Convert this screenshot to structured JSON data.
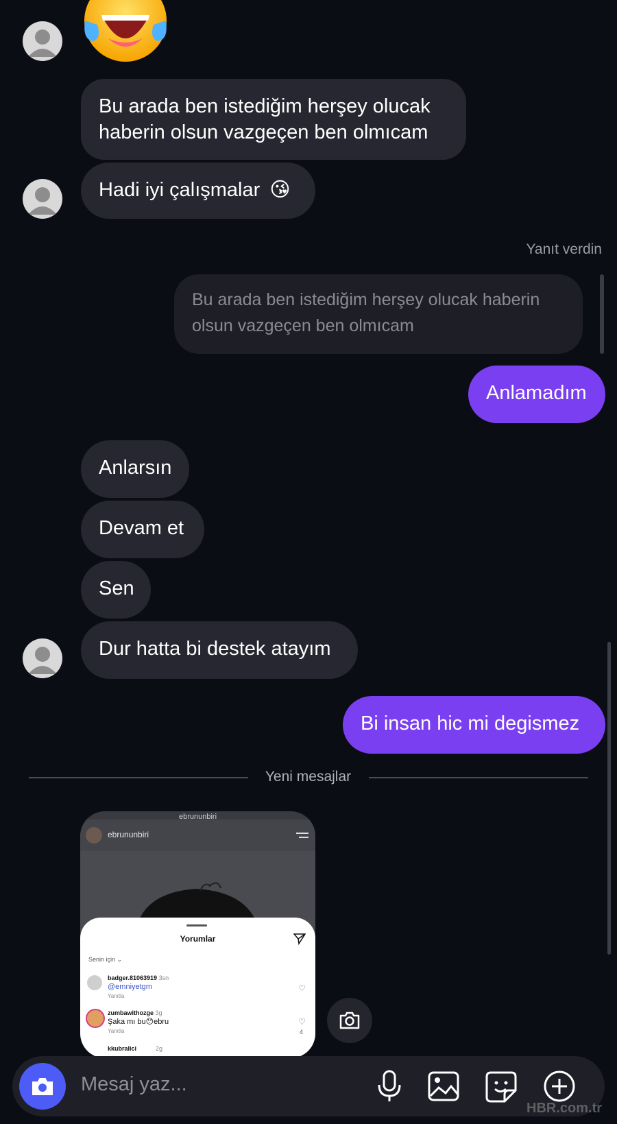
{
  "messages": {
    "in_1": "Bu arada ben istediğim herşey olucak haberin olsun vazgeçen ben olmıcam",
    "in_2": "Hadi iyi çalışmalar",
    "in_2_emoji": "😘",
    "reply_meta": "Yanıt verdin",
    "quoted": "Bu arada ben istediğim herşey olucak haberin olsun vazgeçen ben olmıcam",
    "out_1": "Anlamadım",
    "in_3": "Anlarsın",
    "in_4": "Devam et",
    "in_5": "Sen",
    "in_6": "Dur hatta bi destek atayım",
    "out_2": "Bi insan hic mi degismez"
  },
  "divider": {
    "label": "Yeni mesajlar"
  },
  "shared_post": {
    "top_username": "ebrununbiri",
    "username": "ebrununbiri",
    "comments_title": "Yorumlar",
    "filter": "Senin için",
    "comments": [
      {
        "user": "badger.81063919",
        "time": "3sn",
        "text": "@emniyetgm",
        "reply": "Yanıtla",
        "likes": ""
      },
      {
        "user": "zumbawithozge",
        "time": "3g",
        "text": "Şaka mı bu😯ebru",
        "reply": "Yanıtla",
        "likes": "4"
      },
      {
        "user": "kkubralici",
        "time": "2g",
        "text": "",
        "reply": "",
        "likes": ""
      }
    ]
  },
  "composer": {
    "placeholder": "Mesaj yaz..."
  },
  "watermark": "HBR.com.tr",
  "colors": {
    "accent": "#7b3ff2",
    "camera_button": "#4d5cf6",
    "background": "#0b0d14"
  },
  "icons": [
    "camera-icon",
    "mic-icon",
    "gallery-icon",
    "sticker-icon",
    "plus-icon",
    "send-icon",
    "menu-icon",
    "heart-icon"
  ]
}
